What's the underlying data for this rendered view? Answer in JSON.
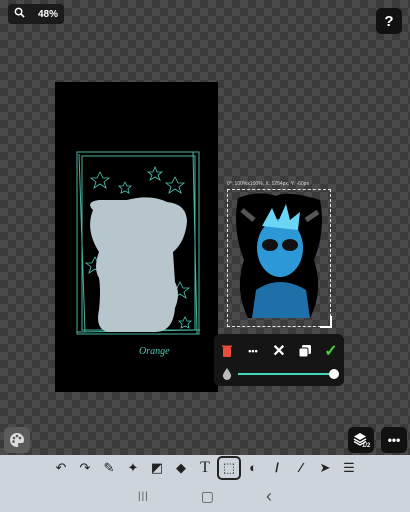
{
  "zoom": {
    "percent": "48%"
  },
  "help": {
    "label": "?"
  },
  "artwork": {
    "signature": "Orange"
  },
  "selection": {
    "caption": "0°: 100%x100%, X: 1254px, Y: -60px"
  },
  "colors": {
    "accent": "#3fd7b8",
    "delete": "#e74c3c",
    "confirm": "#4cd137",
    "canvas": "#000000",
    "toolbar": "#cdd4db"
  },
  "transform_popup": {
    "delete_icon": "trash-icon",
    "more_label": "•••",
    "cancel_label": "✕",
    "duplicate_icon": "duplicate-icon",
    "confirm_label": "✓",
    "opacity": 1.0
  },
  "layers": {
    "badge": "1/2"
  },
  "more": {
    "label": "•••"
  },
  "tools": [
    {
      "name": "undo",
      "glyph": "↶"
    },
    {
      "name": "redo",
      "glyph": "↷"
    },
    {
      "name": "brush",
      "glyph": "✎"
    },
    {
      "name": "spray",
      "glyph": "✦"
    },
    {
      "name": "eraser",
      "glyph": "◩"
    },
    {
      "name": "fill",
      "glyph": "◆"
    },
    {
      "name": "text",
      "glyph": "T"
    },
    {
      "name": "select",
      "glyph": "⬚"
    },
    {
      "name": "shapes",
      "glyph": "◐"
    },
    {
      "name": "pen",
      "glyph": "/"
    },
    {
      "name": "eyedropper",
      "glyph": "⁄"
    },
    {
      "name": "move",
      "glyph": "➤"
    },
    {
      "name": "menu",
      "glyph": "☰"
    }
  ],
  "navigation": {
    "recents": "|||",
    "home": "▢",
    "back": "‹"
  }
}
